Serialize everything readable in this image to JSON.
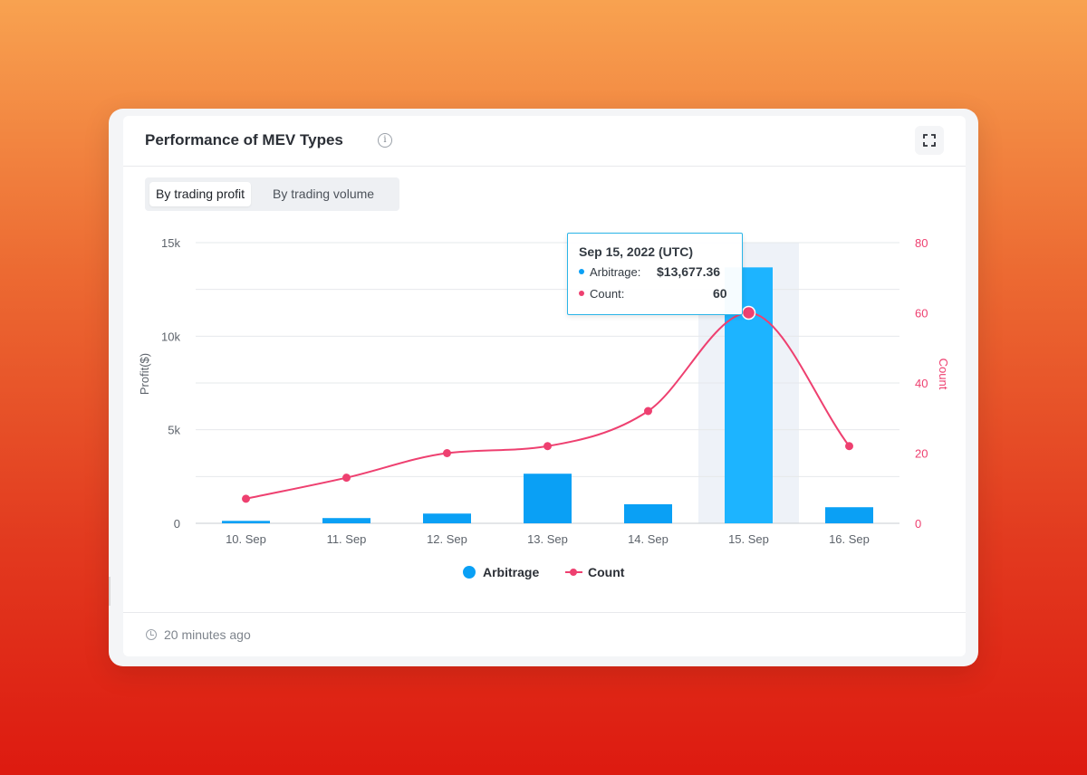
{
  "card": {
    "title": "Performance of MEV Types",
    "info_icon": "info-icon",
    "expand_icon": "expand-icon",
    "tabs": [
      {
        "label": "By trading profit",
        "active": true
      },
      {
        "label": "By trading volume",
        "active": false
      }
    ],
    "footer": {
      "icon": "clock-icon",
      "updated": "20 minutes ago"
    }
  },
  "tooltip": {
    "date": "Sep 15, 2022 (UTC)",
    "rows": [
      {
        "label": "Arbitrage:",
        "value": "$13,677.36"
      },
      {
        "label": "Count:",
        "value": "60"
      }
    ]
  },
  "chart_data": {
    "type": "bar",
    "categories": [
      "10. Sep",
      "11. Sep",
      "12. Sep",
      "13. Sep",
      "14. Sep",
      "15. Sep",
      "16. Sep"
    ],
    "series": [
      {
        "name": "Arbitrage",
        "type": "bar",
        "axis": "left",
        "color": "#0aa0f5",
        "highlight_color": "#1db4ff",
        "values": [
          130,
          280,
          520,
          2650,
          1020,
          13677.36,
          860
        ]
      },
      {
        "name": "Count",
        "type": "line",
        "axis": "right",
        "color": "#ee4070",
        "values": [
          7,
          13,
          20,
          22,
          32,
          60,
          22
        ]
      }
    ],
    "highlighted_category": "15. Sep",
    "y_left": {
      "label": "Profit($)",
      "min": 0,
      "max": 15000,
      "ticks": [
        0,
        5000,
        10000,
        15000
      ],
      "tick_labels": [
        "0",
        "5k",
        "10k",
        "15k"
      ]
    },
    "y_right": {
      "label": "Count",
      "min": 0,
      "max": 80,
      "ticks": [
        0,
        20,
        40,
        60,
        80
      ],
      "tick_labels": [
        "0",
        "20",
        "40",
        "60",
        "80"
      ],
      "color": "#ee4070"
    },
    "grid": true,
    "legend": {
      "position": "bottom",
      "items": [
        "Arbitrage",
        "Count"
      ]
    }
  }
}
